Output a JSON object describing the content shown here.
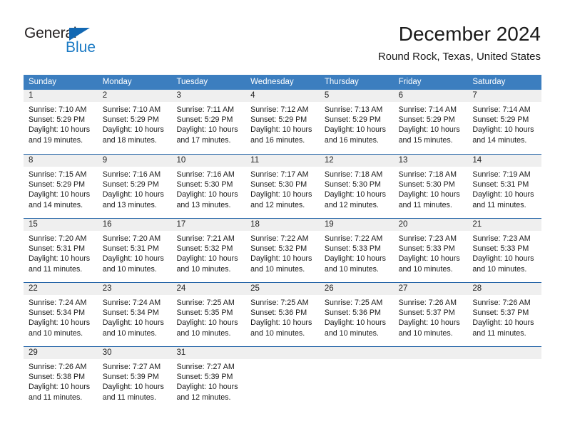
{
  "brand": {
    "name_part1": "General",
    "name_part2": "Blue",
    "triangle_icon": "triangle-icon",
    "accent_color": "#1b7ac4",
    "dark_color": "#231f20"
  },
  "header": {
    "title": "December 2024",
    "subtitle": "Round Rock, Texas, United States"
  },
  "calendar": {
    "header_bg": "#3c7ebf",
    "row_divider_color": "#1f61a5",
    "day_band_bg": "#efefef",
    "weekdays": [
      "Sunday",
      "Monday",
      "Tuesday",
      "Wednesday",
      "Thursday",
      "Friday",
      "Saturday"
    ],
    "weeks": [
      [
        {
          "day": "1",
          "lines": [
            "Sunrise: 7:10 AM",
            "Sunset: 5:29 PM",
            "Daylight: 10 hours",
            "and 19 minutes."
          ]
        },
        {
          "day": "2",
          "lines": [
            "Sunrise: 7:10 AM",
            "Sunset: 5:29 PM",
            "Daylight: 10 hours",
            "and 18 minutes."
          ]
        },
        {
          "day": "3",
          "lines": [
            "Sunrise: 7:11 AM",
            "Sunset: 5:29 PM",
            "Daylight: 10 hours",
            "and 17 minutes."
          ]
        },
        {
          "day": "4",
          "lines": [
            "Sunrise: 7:12 AM",
            "Sunset: 5:29 PM",
            "Daylight: 10 hours",
            "and 16 minutes."
          ]
        },
        {
          "day": "5",
          "lines": [
            "Sunrise: 7:13 AM",
            "Sunset: 5:29 PM",
            "Daylight: 10 hours",
            "and 16 minutes."
          ]
        },
        {
          "day": "6",
          "lines": [
            "Sunrise: 7:14 AM",
            "Sunset: 5:29 PM",
            "Daylight: 10 hours",
            "and 15 minutes."
          ]
        },
        {
          "day": "7",
          "lines": [
            "Sunrise: 7:14 AM",
            "Sunset: 5:29 PM",
            "Daylight: 10 hours",
            "and 14 minutes."
          ]
        }
      ],
      [
        {
          "day": "8",
          "lines": [
            "Sunrise: 7:15 AM",
            "Sunset: 5:29 PM",
            "Daylight: 10 hours",
            "and 14 minutes."
          ]
        },
        {
          "day": "9",
          "lines": [
            "Sunrise: 7:16 AM",
            "Sunset: 5:29 PM",
            "Daylight: 10 hours",
            "and 13 minutes."
          ]
        },
        {
          "day": "10",
          "lines": [
            "Sunrise: 7:16 AM",
            "Sunset: 5:30 PM",
            "Daylight: 10 hours",
            "and 13 minutes."
          ]
        },
        {
          "day": "11",
          "lines": [
            "Sunrise: 7:17 AM",
            "Sunset: 5:30 PM",
            "Daylight: 10 hours",
            "and 12 minutes."
          ]
        },
        {
          "day": "12",
          "lines": [
            "Sunrise: 7:18 AM",
            "Sunset: 5:30 PM",
            "Daylight: 10 hours",
            "and 12 minutes."
          ]
        },
        {
          "day": "13",
          "lines": [
            "Sunrise: 7:18 AM",
            "Sunset: 5:30 PM",
            "Daylight: 10 hours",
            "and 11 minutes."
          ]
        },
        {
          "day": "14",
          "lines": [
            "Sunrise: 7:19 AM",
            "Sunset: 5:31 PM",
            "Daylight: 10 hours",
            "and 11 minutes."
          ]
        }
      ],
      [
        {
          "day": "15",
          "lines": [
            "Sunrise: 7:20 AM",
            "Sunset: 5:31 PM",
            "Daylight: 10 hours",
            "and 11 minutes."
          ]
        },
        {
          "day": "16",
          "lines": [
            "Sunrise: 7:20 AM",
            "Sunset: 5:31 PM",
            "Daylight: 10 hours",
            "and 10 minutes."
          ]
        },
        {
          "day": "17",
          "lines": [
            "Sunrise: 7:21 AM",
            "Sunset: 5:32 PM",
            "Daylight: 10 hours",
            "and 10 minutes."
          ]
        },
        {
          "day": "18",
          "lines": [
            "Sunrise: 7:22 AM",
            "Sunset: 5:32 PM",
            "Daylight: 10 hours",
            "and 10 minutes."
          ]
        },
        {
          "day": "19",
          "lines": [
            "Sunrise: 7:22 AM",
            "Sunset: 5:33 PM",
            "Daylight: 10 hours",
            "and 10 minutes."
          ]
        },
        {
          "day": "20",
          "lines": [
            "Sunrise: 7:23 AM",
            "Sunset: 5:33 PM",
            "Daylight: 10 hours",
            "and 10 minutes."
          ]
        },
        {
          "day": "21",
          "lines": [
            "Sunrise: 7:23 AM",
            "Sunset: 5:33 PM",
            "Daylight: 10 hours",
            "and 10 minutes."
          ]
        }
      ],
      [
        {
          "day": "22",
          "lines": [
            "Sunrise: 7:24 AM",
            "Sunset: 5:34 PM",
            "Daylight: 10 hours",
            "and 10 minutes."
          ]
        },
        {
          "day": "23",
          "lines": [
            "Sunrise: 7:24 AM",
            "Sunset: 5:34 PM",
            "Daylight: 10 hours",
            "and 10 minutes."
          ]
        },
        {
          "day": "24",
          "lines": [
            "Sunrise: 7:25 AM",
            "Sunset: 5:35 PM",
            "Daylight: 10 hours",
            "and 10 minutes."
          ]
        },
        {
          "day": "25",
          "lines": [
            "Sunrise: 7:25 AM",
            "Sunset: 5:36 PM",
            "Daylight: 10 hours",
            "and 10 minutes."
          ]
        },
        {
          "day": "26",
          "lines": [
            "Sunrise: 7:25 AM",
            "Sunset: 5:36 PM",
            "Daylight: 10 hours",
            "and 10 minutes."
          ]
        },
        {
          "day": "27",
          "lines": [
            "Sunrise: 7:26 AM",
            "Sunset: 5:37 PM",
            "Daylight: 10 hours",
            "and 10 minutes."
          ]
        },
        {
          "day": "28",
          "lines": [
            "Sunrise: 7:26 AM",
            "Sunset: 5:37 PM",
            "Daylight: 10 hours",
            "and 11 minutes."
          ]
        }
      ],
      [
        {
          "day": "29",
          "lines": [
            "Sunrise: 7:26 AM",
            "Sunset: 5:38 PM",
            "Daylight: 10 hours",
            "and 11 minutes."
          ]
        },
        {
          "day": "30",
          "lines": [
            "Sunrise: 7:27 AM",
            "Sunset: 5:39 PM",
            "Daylight: 10 hours",
            "and 11 minutes."
          ]
        },
        {
          "day": "31",
          "lines": [
            "Sunrise: 7:27 AM",
            "Sunset: 5:39 PM",
            "Daylight: 10 hours",
            "and 12 minutes."
          ]
        },
        {
          "day": "",
          "lines": []
        },
        {
          "day": "",
          "lines": []
        },
        {
          "day": "",
          "lines": []
        },
        {
          "day": "",
          "lines": []
        }
      ]
    ]
  }
}
